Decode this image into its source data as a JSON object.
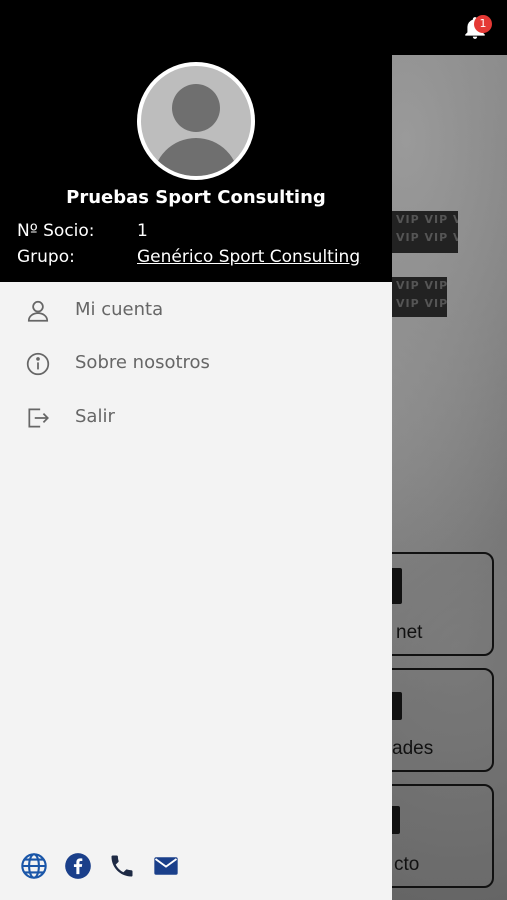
{
  "topbar": {
    "notification_count": "1",
    "icons": [
      "bell-icon"
    ]
  },
  "background": {
    "cards": [
      {
        "label": "net"
      },
      {
        "label": "ades"
      },
      {
        "label": "cto"
      }
    ],
    "vip_text": "VIP VIP VIP VIP VIP VIP VIP VIP"
  },
  "drawer": {
    "user_name": "Pruebas Sport Consulting",
    "member_label": "Nº Socio:",
    "member_value": "1",
    "group_label": "Grupo:",
    "group_value": "Genérico Sport Consulting",
    "menu": [
      {
        "label": "Mi cuenta",
        "icon": "user-icon"
      },
      {
        "label": "Sobre nosotros",
        "icon": "info-icon"
      },
      {
        "label": "Salir",
        "icon": "logout-icon"
      }
    ],
    "footer_icons": [
      "globe-icon",
      "facebook-icon",
      "phone-icon",
      "mail-icon"
    ]
  },
  "colors": {
    "header_bg": "#000000",
    "drawer_bg": "#f3f3f3",
    "accent_blue": "#1a56a8",
    "badge_red": "#e53935"
  }
}
